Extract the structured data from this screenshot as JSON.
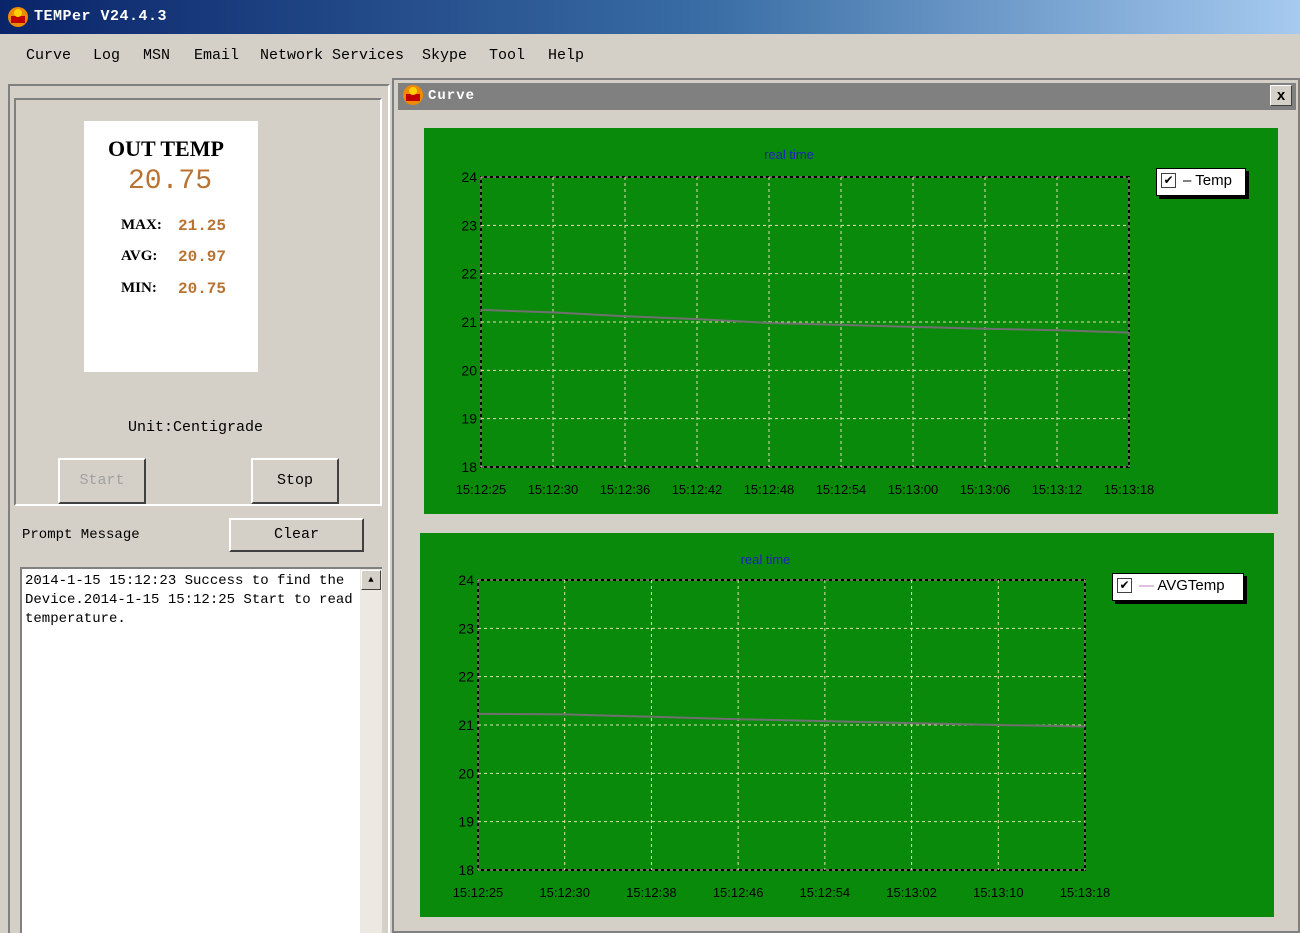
{
  "window": {
    "title": "TEMPer V24.4.3"
  },
  "menu": [
    "Curve",
    "Log",
    "MSN",
    "Email",
    "Network Services",
    "Skype",
    "Tool",
    "Help"
  ],
  "reading": {
    "label": "OUT TEMP",
    "current": "20.75",
    "max_key": "MAX:",
    "max": "21.25",
    "avg_key": "AVG:",
    "avg": "20.97",
    "min_key": "MIN:",
    "min": "20.75",
    "unit": "Unit:Centigrade"
  },
  "controls": {
    "start_label": "Start",
    "stop_label": "Stop",
    "clear_label": "Clear",
    "prompt_label": "Prompt Message"
  },
  "messages": "2014-1-15 15:12:23 Success to find the Device.2014-1-15 15:12:25 Start to read temperature.",
  "curve_window": {
    "title": "Curve",
    "close_label": "x"
  },
  "colors": {
    "chart_bg": "#0a8a0a",
    "grid": "#e0e0b0",
    "line": "#707070",
    "title": "#2020c0",
    "accent": "#b87333"
  },
  "chart_data": [
    {
      "type": "line",
      "title": "real time",
      "xlabel": "",
      "ylabel": "",
      "ylim": [
        18,
        24
      ],
      "yticks": [
        24,
        23,
        22,
        21,
        20,
        19,
        18
      ],
      "categories": [
        "15:12:25",
        "15:12:30",
        "15:12:36",
        "15:12:42",
        "15:12:48",
        "15:12:54",
        "15:13:00",
        "15:13:06",
        "15:13:12",
        "15:13:18"
      ],
      "series": [
        {
          "name": "Temp",
          "values": [
            21.25,
            21.2,
            21.12,
            21.06,
            20.98,
            20.94,
            20.9,
            20.86,
            20.83,
            20.78
          ]
        }
      ],
      "legend": "top-right",
      "grid": true
    },
    {
      "type": "line",
      "title": "real time",
      "xlabel": "",
      "ylabel": "",
      "ylim": [
        18,
        24
      ],
      "yticks": [
        24,
        23,
        22,
        21,
        20,
        19,
        18
      ],
      "categories": [
        "15:12:25",
        "15:12:30",
        "15:12:38",
        "15:12:46",
        "15:12:54",
        "15:13:02",
        "15:13:10",
        "15:13:18"
      ],
      "series": [
        {
          "name": "AVGTemp",
          "values": [
            21.23,
            21.22,
            21.17,
            21.12,
            21.08,
            21.04,
            21.0,
            20.97
          ]
        }
      ],
      "legend": "top-right",
      "grid": true
    }
  ]
}
